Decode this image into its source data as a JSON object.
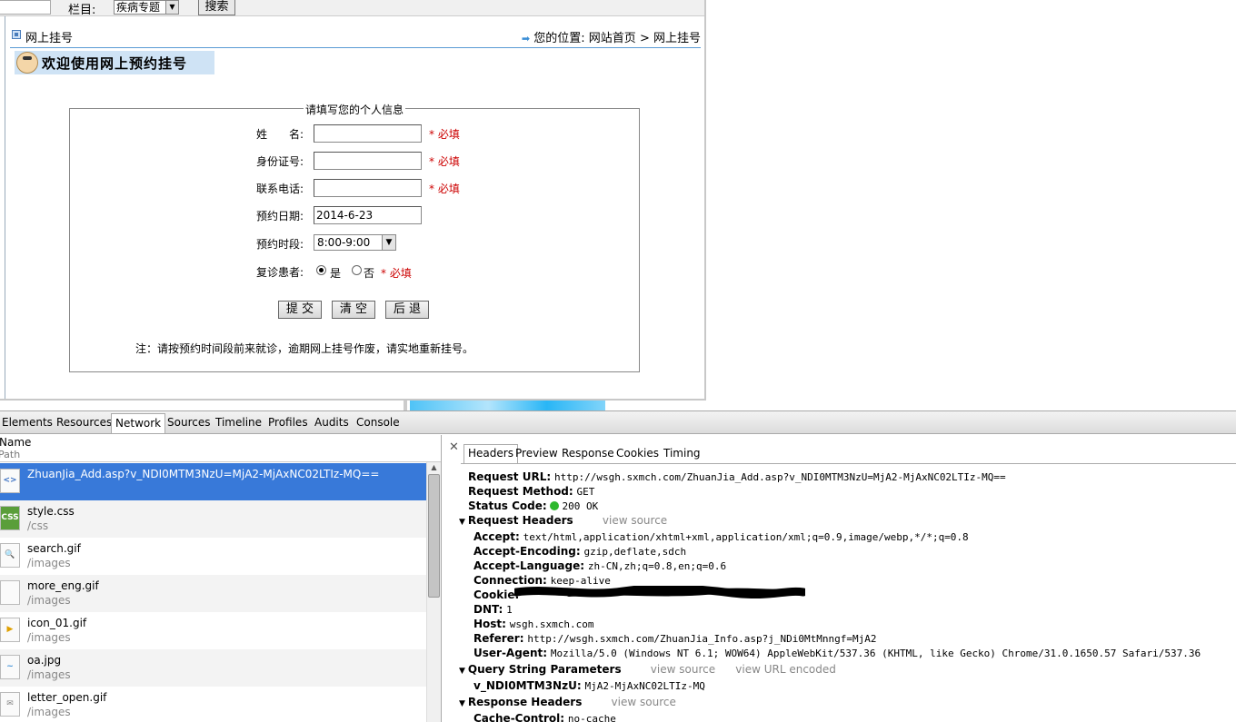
{
  "topbar": {
    "category_label": "栏目:",
    "category_value": "疾病专题",
    "search_button": "搜索"
  },
  "page": {
    "title": "网上挂号",
    "location_label": "您的位置:",
    "breadcrumb_home": "网站首页",
    "breadcrumb_sep": ">",
    "breadcrumb_current": "网上挂号",
    "welcome_banner": "欢迎使用网上预约挂号"
  },
  "form": {
    "legend": "请填写您的个人信息",
    "name_label": "姓　　名:",
    "id_label": "身份证号:",
    "phone_label": "联系电话:",
    "date_label": "预约日期:",
    "date_value": "2014-6-23",
    "time_label": "预约时段:",
    "time_value": "8:00-9:00",
    "revisit_label": "复诊患者:",
    "revisit_yes": "是",
    "revisit_no": "否",
    "required_text": "* 必填",
    "submit_button": "提 交",
    "clear_button": "清 空",
    "back_button": "后 退",
    "note": "注：请按预约时间段前来就诊，逾期网上挂号作废，请实地重新挂号。"
  },
  "devtools": {
    "tabs": [
      "Elements",
      "Resources",
      "Network",
      "Sources",
      "Timeline",
      "Profiles",
      "Audits",
      "Console"
    ],
    "active_tab": "Network",
    "list_header_name": "Name",
    "list_header_path": "Path",
    "requests": [
      {
        "name": "ZhuanJia_Add.asp?v_NDI0MTM3NzU=MjA2-MjAxNC02LTIz-MQ==",
        "path": "",
        "icon": "html-file-icon",
        "icon_text": "<>"
      },
      {
        "name": "style.css",
        "path": "/css",
        "icon": "css-file-icon",
        "icon_text": "CSS"
      },
      {
        "name": "search.gif",
        "path": "/images",
        "icon": "search-gif-icon",
        "icon_text": "🔍"
      },
      {
        "name": "more_eng.gif",
        "path": "/images",
        "icon": "image-file-icon",
        "icon_text": ""
      },
      {
        "name": "icon_01.gif",
        "path": "/images",
        "icon": "play-gif-icon",
        "icon_text": "▶"
      },
      {
        "name": "oa.jpg",
        "path": "/images",
        "icon": "image-file-icon",
        "icon_text": "~"
      },
      {
        "name": "letter_open.gif",
        "path": "/images",
        "icon": "envelope-gif-icon",
        "icon_text": "✉"
      }
    ],
    "detail_tabs": [
      "Headers",
      "Preview",
      "Response",
      "Cookies",
      "Timing"
    ],
    "active_detail_tab": "Headers",
    "general": {
      "request_url_key": "Request URL:",
      "request_url": "http://wsgh.sxmch.com/ZhuanJia_Add.asp?v_NDI0MTM3NzU=MjA2-MjAxNC02LTIz-MQ==",
      "request_method_key": "Request Method:",
      "request_method": "GET",
      "status_code_key": "Status Code:",
      "status_code": "200 OK",
      "status_color": "#2eb82e"
    },
    "request_headers_title": "Request Headers",
    "view_source": "view source",
    "view_url_encoded": "view URL encoded",
    "request_headers": [
      {
        "key": "Accept:",
        "value": "text/html,application/xhtml+xml,application/xml;q=0.9,image/webp,*/*;q=0.8"
      },
      {
        "key": "Accept-Encoding:",
        "value": "gzip,deflate,sdch"
      },
      {
        "key": "Accept-Language:",
        "value": "zh-CN,zh;q=0.8,en;q=0.6"
      },
      {
        "key": "Connection:",
        "value": "keep-alive"
      },
      {
        "key": "Cookie:",
        "value": ""
      },
      {
        "key": "DNT:",
        "value": "1"
      },
      {
        "key": "Host:",
        "value": "wsgh.sxmch.com"
      },
      {
        "key": "Referer:",
        "value": "http://wsgh.sxmch.com/ZhuanJia_Info.asp?j_NDi0MtMnngf=MjA2"
      },
      {
        "key": "User-Agent:",
        "value": "Mozilla/5.0 (Windows NT 6.1; WOW64) AppleWebKit/537.36 (KHTML, like Gecko) Chrome/31.0.1650.57 Safari/537.36"
      }
    ],
    "query_params_title": "Query String Parameters",
    "query_params": [
      {
        "key": "v_NDI0MTM3NzU:",
        "value": "MjA2-MjAxNC02LTIz-MQ"
      }
    ],
    "response_headers_title": "Response Headers",
    "response_headers": [
      {
        "key": "Cache-Control:",
        "value": "no-cache"
      }
    ]
  }
}
